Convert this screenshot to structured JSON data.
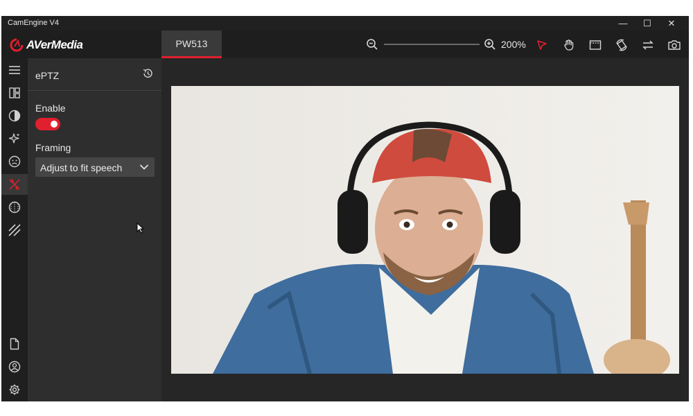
{
  "window": {
    "title": "CamEngine V4",
    "controls": [
      "—",
      "☐",
      "✕"
    ]
  },
  "brand": {
    "logo_text": "AVerMedia",
    "accent": "#e0202e"
  },
  "tabs": [
    {
      "label": "PW513",
      "active": true
    }
  ],
  "toolbar": {
    "zoom_level": "200%",
    "icons": [
      "zoom-out-icon",
      "zoom-in-icon",
      "pointer-icon",
      "hand-icon",
      "frame-icon",
      "rotate-icon",
      "swap-icon",
      "camera-icon"
    ]
  },
  "sidebar": {
    "items": [
      "menu-icon",
      "layout-icon",
      "color-icon",
      "effects-icon",
      "face-icon",
      "eptz-icon",
      "filter-icon",
      "pattern-icon",
      "file-icon",
      "account-icon",
      "settings-icon"
    ],
    "active": "eptz-icon"
  },
  "panel": {
    "title": "ePTZ",
    "enable_label": "Enable",
    "enabled": true,
    "framing_label": "Framing",
    "framing_value": "Adjust to fit speech"
  },
  "preview": {
    "description_icon": "camera-preview"
  }
}
